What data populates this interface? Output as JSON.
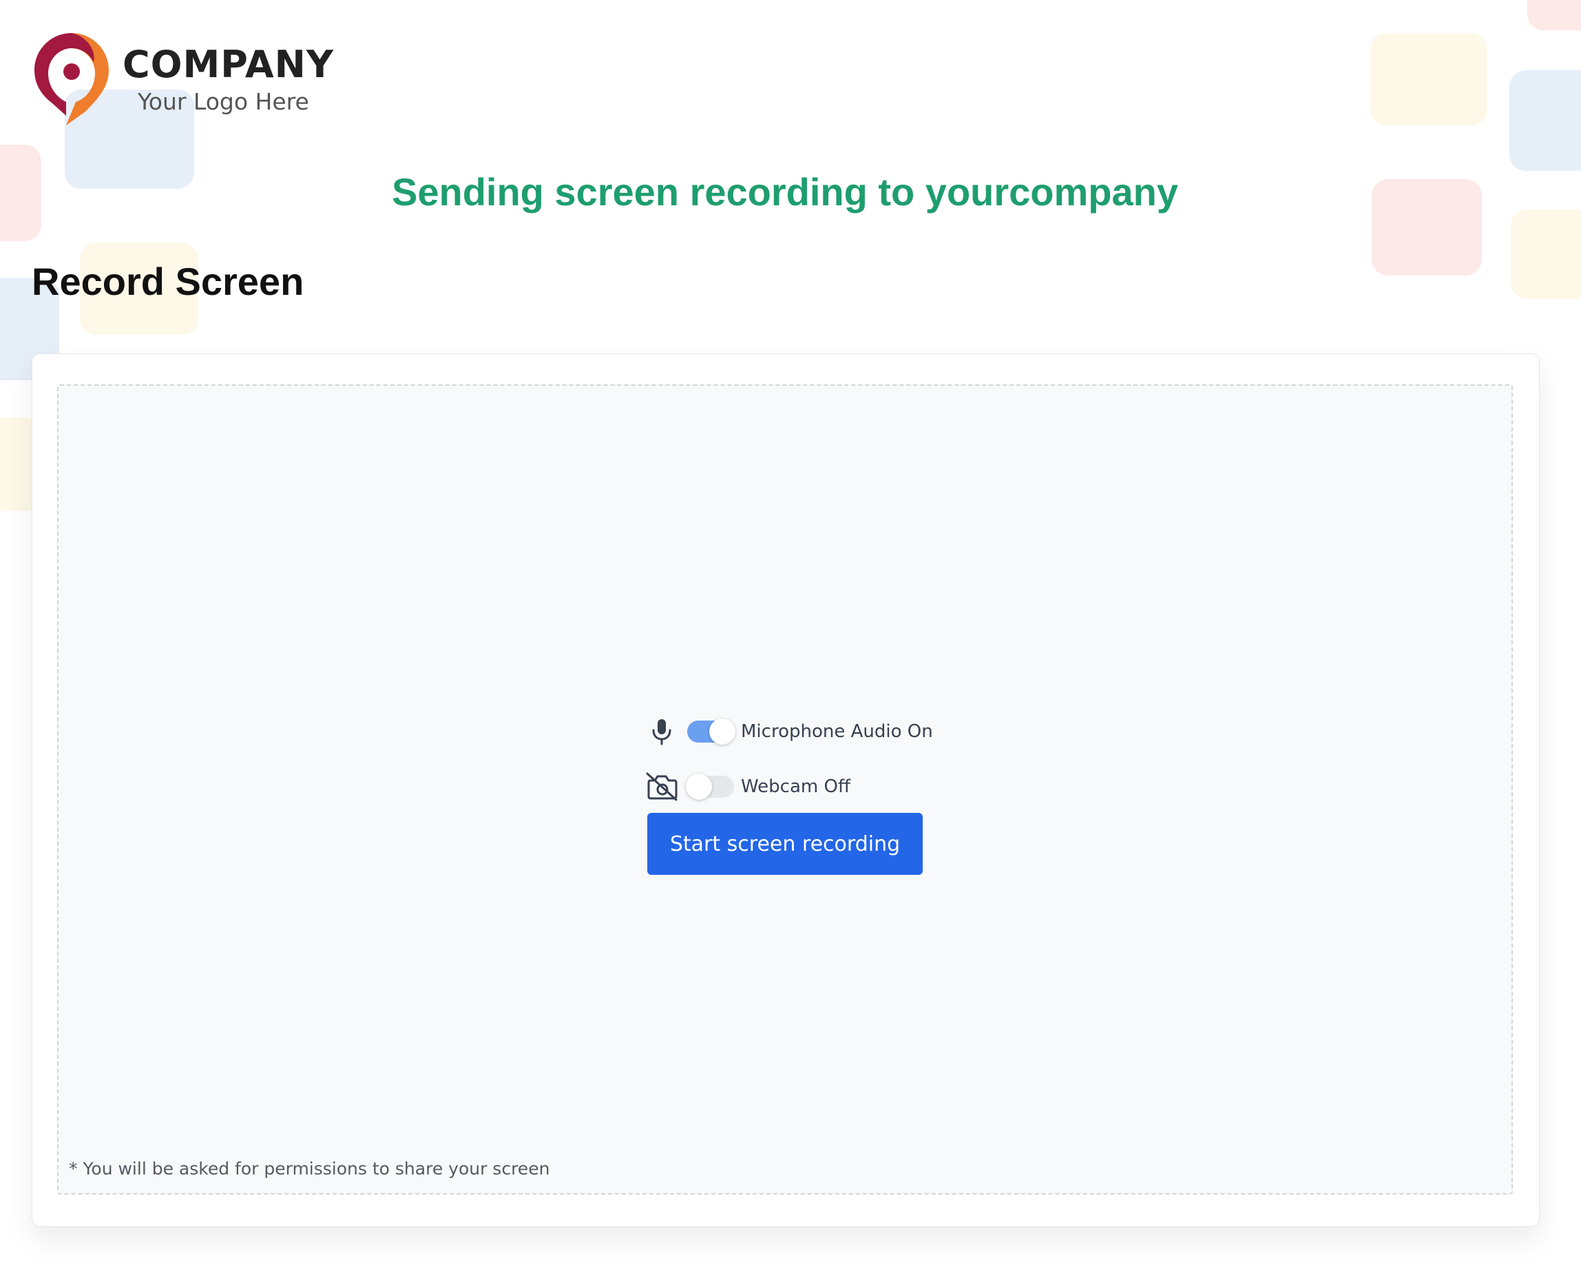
{
  "brand": {
    "company": "COMPANY",
    "tagline": "Your Logo Here"
  },
  "headline": "Sending screen recording to yourcompany",
  "page_title": "Record Screen",
  "controls": {
    "microphone": {
      "label": "Microphone Audio On",
      "enabled": true,
      "icon": "microphone-icon"
    },
    "webcam": {
      "label": "Webcam Off",
      "enabled": false,
      "icon": "camera-off-icon"
    }
  },
  "start_button_label": "Start screen recording",
  "footnote": "* You will be asked for permissions to share your screen",
  "colors": {
    "headline": "#1e9e6e",
    "primary_button": "#2366e8",
    "toggle_on": "#6b9ff0",
    "logo_red": "#a3193f",
    "logo_orange": "#ee7d2c"
  }
}
